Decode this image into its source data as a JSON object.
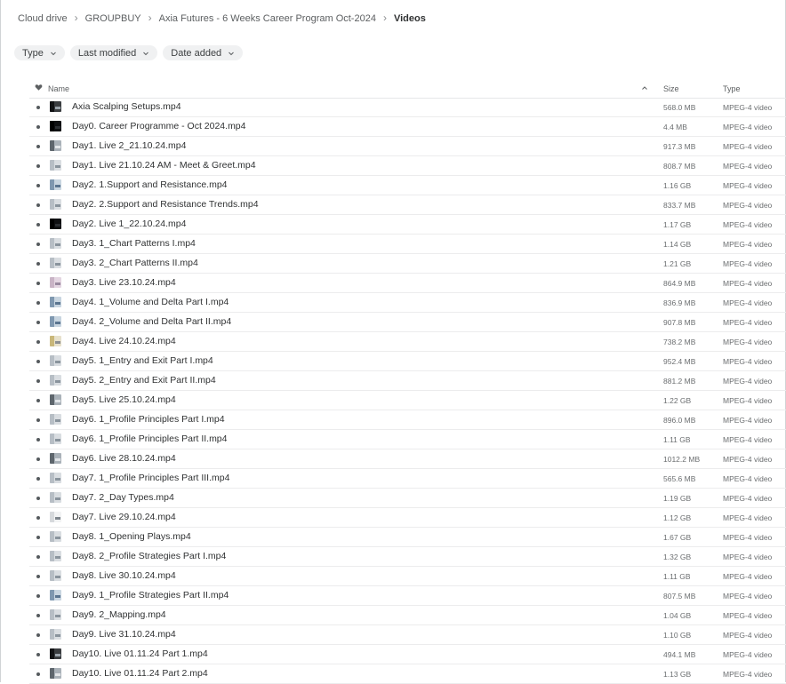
{
  "breadcrumb": [
    "Cloud drive",
    "GROUPBUY",
    "Axia Futures - 6 Weeks Career Program Oct-2024",
    "Videos"
  ],
  "filters": {
    "type": "Type",
    "last_modified": "Last modified",
    "date_added": "Date added"
  },
  "columns": {
    "name": "Name",
    "size": "Size",
    "type": "Type"
  },
  "sort": {
    "column": "Name",
    "direction": "ascending"
  },
  "colors": {
    "text": "#303233",
    "muted": "#6b6e70",
    "chip_bg": "#f0f1f2",
    "divider": "#ececed"
  },
  "files": [
    {
      "name": "Axia Scalping Setups.mp4",
      "size": "568.0 MB",
      "type": "MPEG-4 video",
      "thumb": "dark"
    },
    {
      "name": "Day0. Career Programme - Oct 2024.mp4",
      "size": "4.4 MB",
      "type": "MPEG-4 video",
      "thumb": "black"
    },
    {
      "name": "Day1. Live 2_21.10.24.mp4",
      "size": "917.3 MB",
      "type": "MPEG-4 video",
      "thumb": "mid"
    },
    {
      "name": "Day1. Live 21.10.24 AM - Meet & Greet.mp4",
      "size": "808.7 MB",
      "type": "MPEG-4 video",
      "thumb": "light"
    },
    {
      "name": "Day2. 1.Support and Resistance.mp4",
      "size": "1.16 GB",
      "type": "MPEG-4 video",
      "thumb": "blue"
    },
    {
      "name": "Day2. 2.Support and Resistance Trends.mp4",
      "size": "833.7 MB",
      "type": "MPEG-4 video",
      "thumb": "light"
    },
    {
      "name": "Day2. Live 1_22.10.24.mp4",
      "size": "1.17 GB",
      "type": "MPEG-4 video",
      "thumb": "black"
    },
    {
      "name": "Day3. 1_Chart Patterns I.mp4",
      "size": "1.14 GB",
      "type": "MPEG-4 video",
      "thumb": "light"
    },
    {
      "name": "Day3. 2_Chart Patterns II.mp4",
      "size": "1.21 GB",
      "type": "MPEG-4 video",
      "thumb": "light"
    },
    {
      "name": "Day3. Live 23.10.24.mp4",
      "size": "864.9 MB",
      "type": "MPEG-4 video",
      "thumb": "pink"
    },
    {
      "name": "Day4. 1_Volume and Delta Part I.mp4",
      "size": "836.9 MB",
      "type": "MPEG-4 video",
      "thumb": "blue"
    },
    {
      "name": "Day4. 2_Volume and Delta Part II.mp4",
      "size": "907.8 MB",
      "type": "MPEG-4 video",
      "thumb": "blue"
    },
    {
      "name": "Day4. Live 24.10.24.mp4",
      "size": "738.2 MB",
      "type": "MPEG-4 video",
      "thumb": "yellow"
    },
    {
      "name": "Day5. 1_Entry and Exit Part I.mp4",
      "size": "952.4 MB",
      "type": "MPEG-4 video",
      "thumb": "light"
    },
    {
      "name": "Day5. 2_Entry and Exit Part II.mp4",
      "size": "881.2 MB",
      "type": "MPEG-4 video",
      "thumb": "light"
    },
    {
      "name": "Day5. Live 25.10.24.mp4",
      "size": "1.22 GB",
      "type": "MPEG-4 video",
      "thumb": "mid"
    },
    {
      "name": "Day6. 1_Profile Principles Part I.mp4",
      "size": "896.0 MB",
      "type": "MPEG-4 video",
      "thumb": "light"
    },
    {
      "name": "Day6. 1_Profile Principles Part II.mp4",
      "size": "1.11 GB",
      "type": "MPEG-4 video",
      "thumb": "light"
    },
    {
      "name": "Day6. Live 28.10.24.mp4",
      "size": "1012.2 MB",
      "type": "MPEG-4 video",
      "thumb": "mid"
    },
    {
      "name": "Day7. 1_Profile Principles Part III.mp4",
      "size": "565.6 MB",
      "type": "MPEG-4 video",
      "thumb": "light"
    },
    {
      "name": "Day7. 2_Day Types.mp4",
      "size": "1.19 GB",
      "type": "MPEG-4 video",
      "thumb": "light"
    },
    {
      "name": "Day7. Live 29.10.24.mp4",
      "size": "1.12 GB",
      "type": "MPEG-4 video",
      "thumb": "white"
    },
    {
      "name": "Day8. 1_Opening Plays.mp4",
      "size": "1.67 GB",
      "type": "MPEG-4 video",
      "thumb": "light"
    },
    {
      "name": "Day8. 2_Profile Strategies Part I.mp4",
      "size": "1.32 GB",
      "type": "MPEG-4 video",
      "thumb": "light"
    },
    {
      "name": "Day8. Live 30.10.24.mp4",
      "size": "1.11 GB",
      "type": "MPEG-4 video",
      "thumb": "light"
    },
    {
      "name": "Day9. 1_Profile Strategies Part II.mp4",
      "size": "807.5 MB",
      "type": "MPEG-4 video",
      "thumb": "blue"
    },
    {
      "name": "Day9. 2_Mapping.mp4",
      "size": "1.04 GB",
      "type": "MPEG-4 video",
      "thumb": "light"
    },
    {
      "name": "Day9. Live 31.10.24.mp4",
      "size": "1.10 GB",
      "type": "MPEG-4 video",
      "thumb": "light"
    },
    {
      "name": "Day10. Live 01.11.24 Part 1.mp4",
      "size": "494.1 MB",
      "type": "MPEG-4 video",
      "thumb": "dark"
    },
    {
      "name": "Day10. Live 01.11.24 Part 2.mp4",
      "size": "1.13 GB",
      "type": "MPEG-4 video",
      "thumb": "mid"
    }
  ]
}
